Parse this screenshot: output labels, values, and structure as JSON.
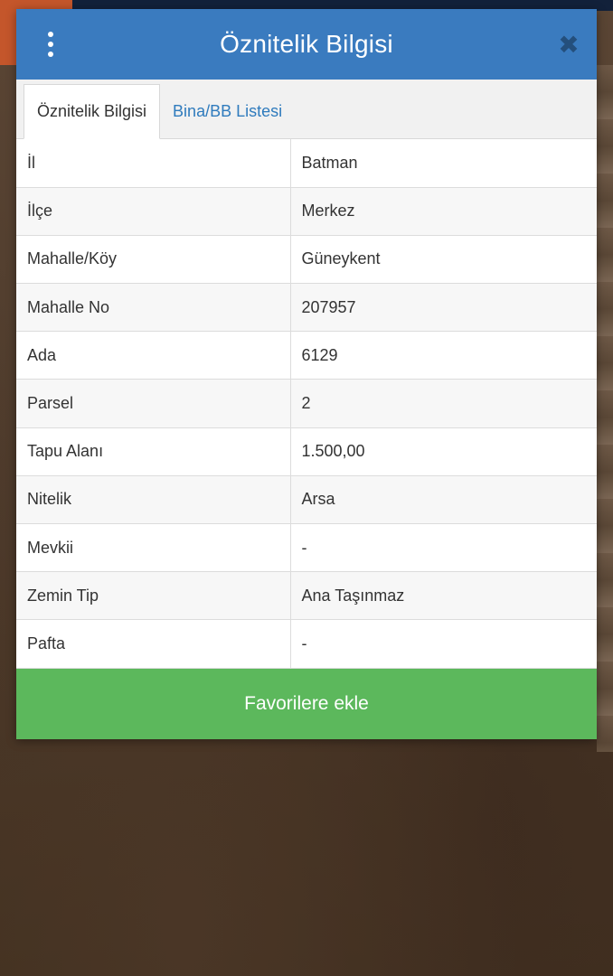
{
  "dialog": {
    "title": "Öznitelik Bilgisi",
    "close_glyph": "✖",
    "tabs": [
      {
        "label": "Öznitelik Bilgisi",
        "active": true
      },
      {
        "label": "Bina/BB Listesi",
        "active": false
      }
    ],
    "rows": [
      {
        "label": "İl",
        "value": "Batman"
      },
      {
        "label": "İlçe",
        "value": "Merkez"
      },
      {
        "label": "Mahalle/Köy",
        "value": "Güneykent"
      },
      {
        "label": "Mahalle No",
        "value": "207957"
      },
      {
        "label": "Ada",
        "value": "6129"
      },
      {
        "label": "Parsel",
        "value": "2"
      },
      {
        "label": "Tapu Alanı",
        "value": "1.500,00"
      },
      {
        "label": "Nitelik",
        "value": "Arsa"
      },
      {
        "label": "Mevkii",
        "value": "-"
      },
      {
        "label": "Zemin Tip",
        "value": "Ana Taşınmaz"
      },
      {
        "label": "Pafta",
        "value": "-"
      }
    ],
    "favorite_button": "Favorilere ekle"
  },
  "colors": {
    "header": "#3a7bbf",
    "accent_link": "#2f7bbd",
    "favorite_button": "#5cb85c"
  },
  "icons": {
    "menu": "more-vertical-icon",
    "close": "close-icon"
  }
}
